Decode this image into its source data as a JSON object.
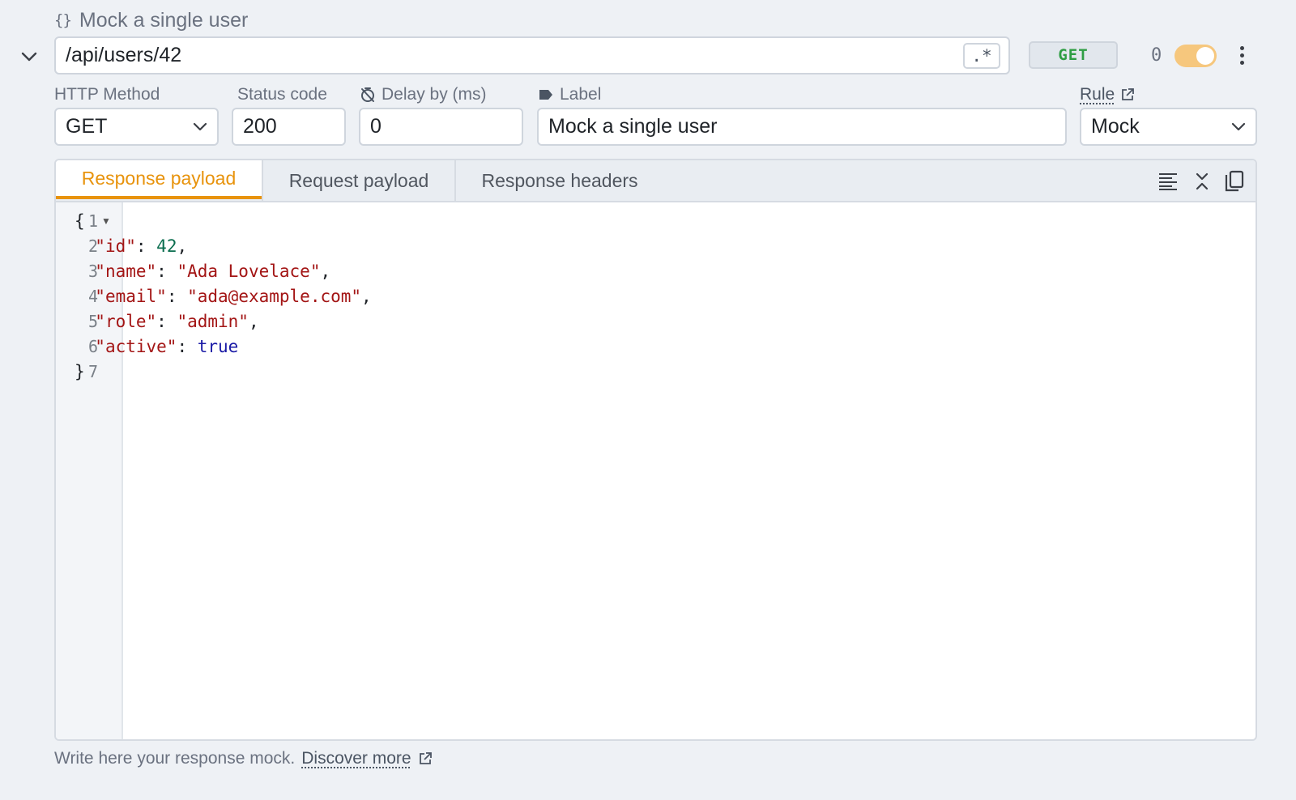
{
  "header": {
    "title": "Mock a single user",
    "url": "/api/users/42",
    "regex_label": ".*",
    "method_badge": "GET",
    "hit_count": "0",
    "enabled": true
  },
  "fields": {
    "http_method": {
      "label": "HTTP Method",
      "value": "GET"
    },
    "status_code": {
      "label": "Status code",
      "value": "200"
    },
    "delay": {
      "label": "Delay by (ms)",
      "value": "0"
    },
    "label": {
      "label": "Label",
      "value": "Mock a single user"
    },
    "rule": {
      "label": "Rule",
      "value": "Mock"
    }
  },
  "tabs": [
    {
      "label": "Response payload",
      "active": true
    },
    {
      "label": "Request payload",
      "active": false
    },
    {
      "label": "Response headers",
      "active": false
    }
  ],
  "editor": {
    "line_numbers": [
      "1",
      "2",
      "3",
      "4",
      "5",
      "6",
      "7"
    ],
    "lines": [
      {
        "tokens": [
          {
            "t": "{",
            "c": ""
          }
        ]
      },
      {
        "tokens": [
          {
            "t": "  ",
            "c": ""
          },
          {
            "t": "\"id\"",
            "c": "k"
          },
          {
            "t": ": ",
            "c": ""
          },
          {
            "t": "42",
            "c": "n"
          },
          {
            "t": ",",
            "c": ""
          }
        ]
      },
      {
        "tokens": [
          {
            "t": "  ",
            "c": ""
          },
          {
            "t": "\"name\"",
            "c": "k"
          },
          {
            "t": ": ",
            "c": ""
          },
          {
            "t": "\"Ada Lovelace\"",
            "c": "s"
          },
          {
            "t": ",",
            "c": ""
          }
        ]
      },
      {
        "tokens": [
          {
            "t": "  ",
            "c": ""
          },
          {
            "t": "\"email\"",
            "c": "k"
          },
          {
            "t": ": ",
            "c": ""
          },
          {
            "t": "\"ada@example.com\"",
            "c": "s"
          },
          {
            "t": ",",
            "c": ""
          }
        ]
      },
      {
        "tokens": [
          {
            "t": "  ",
            "c": ""
          },
          {
            "t": "\"role\"",
            "c": "k"
          },
          {
            "t": ": ",
            "c": ""
          },
          {
            "t": "\"admin\"",
            "c": "s"
          },
          {
            "t": ",",
            "c": ""
          }
        ]
      },
      {
        "tokens": [
          {
            "t": "  ",
            "c": ""
          },
          {
            "t": "\"active\"",
            "c": "k"
          },
          {
            "t": ": ",
            "c": ""
          },
          {
            "t": "true",
            "c": "b"
          }
        ]
      },
      {
        "tokens": [
          {
            "t": "}",
            "c": ""
          }
        ]
      }
    ]
  },
  "footer": {
    "hint_text": "Write here your response mock.",
    "link_text": "Discover more"
  },
  "icons": {
    "title": "braces-icon",
    "collapse": "chevron-down-icon",
    "delay": "timer-off-icon",
    "label": "tag-icon",
    "rule_link": "external-link-icon",
    "tools": [
      "format-icon",
      "collapse-all-icon",
      "copy-icon"
    ],
    "footer_link": "external-link-icon"
  },
  "colors": {
    "accent": "#e8930c",
    "method_get": "#2f9e44",
    "toggle_on": "#f6c77d",
    "json_key": "#a31515",
    "json_number": "#0b6e4f",
    "json_boolean": "#1a1aa6"
  }
}
